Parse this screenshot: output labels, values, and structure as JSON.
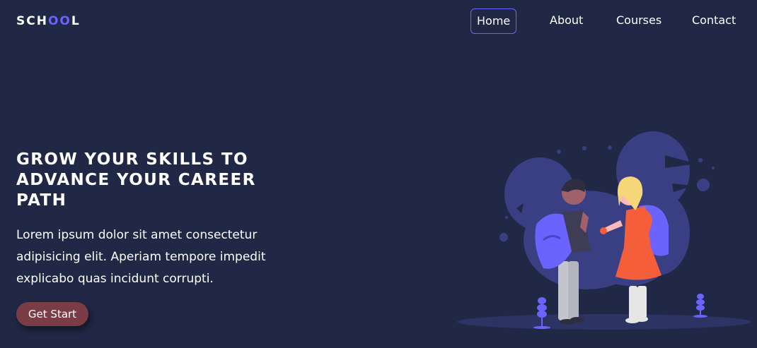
{
  "header": {
    "logo_prefix": "SCH",
    "logo_accent": "OO",
    "logo_suffix": "L"
  },
  "nav": {
    "items": [
      {
        "label": "Home",
        "active": true
      },
      {
        "label": "About",
        "active": false
      },
      {
        "label": "Courses",
        "active": false
      },
      {
        "label": "Contact",
        "active": false
      }
    ]
  },
  "hero": {
    "title": "GROW YOUR SKILLS TO ADVANCE YOUR CAREER PATH",
    "text": "Lorem ipsum dolor sit amet consectetur adipisicing elit. Aperiam tempore impedit explicabo quas incidunt corrupti.",
    "cta_label": "Get Start"
  },
  "colors": {
    "background": "#212846",
    "accent": "#6c63ff",
    "button": "#7a3c45",
    "blob": "#3a3f84"
  },
  "illustration": {
    "icon": "students-with-backpacks-illustration"
  }
}
